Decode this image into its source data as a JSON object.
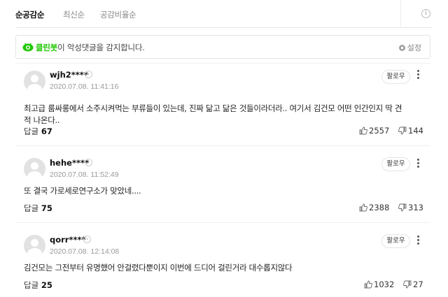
{
  "tabs": [
    {
      "label": "순공감순",
      "active": true
    },
    {
      "label": "최신순",
      "active": false
    },
    {
      "label": "공감비율순",
      "active": false
    }
  ],
  "cleanbot": {
    "brand": "클린봇",
    "message": "이 악성댓글을 감지합니다.",
    "settings_label": "설정"
  },
  "follow_label": "팔로우",
  "reply_prefix": "답글",
  "comments": [
    {
      "nick": "wjh2****",
      "date": "2020.07.08. 11:41:16",
      "text": "최고급 룸싸롱에서 소주시켜먹는 부류들이 있는데, 진짜 닮고 닮은 것들이라더라.. 여기서 김건모 어떤 인간인지 딱 견적 나온다..",
      "replies": "67",
      "likes": "2557",
      "dislikes": "144"
    },
    {
      "nick": "hehe****",
      "date": "2020.07.08. 11:52:49",
      "text": "또 결국 가로세로연구소가 맞았네....",
      "replies": "75",
      "likes": "2388",
      "dislikes": "313"
    },
    {
      "nick": "qorr****",
      "date": "2020.07.08. 12:14:08",
      "text": "김건모는 그전부터 유명했어 안걸렸다뿐이지 이번에 드디어 걸린거라 대수롭지않다",
      "replies": "25",
      "likes": "1032",
      "dislikes": "27"
    }
  ]
}
